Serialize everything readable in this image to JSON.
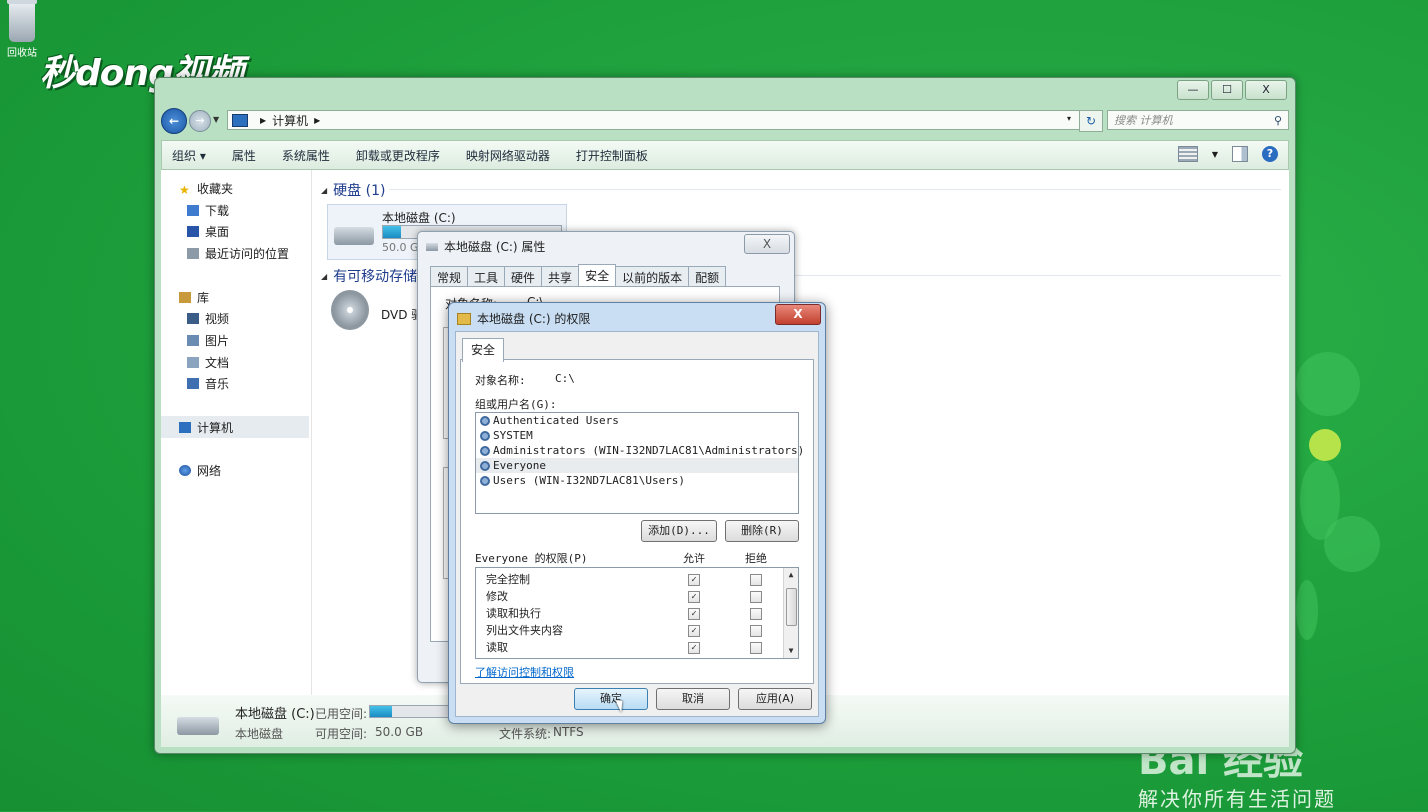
{
  "desktop": {
    "recycle_bin_label": "回收站",
    "brand_logo": "秒dong视频",
    "watermark_main": "Bai 经验",
    "watermark_sub": "解决你所有生活问题"
  },
  "explorer": {
    "window_buttons": {
      "minimize": "—",
      "maximize": "☐",
      "close": "X"
    },
    "address": {
      "root": "计算机",
      "dropdown": "▾"
    },
    "search_placeholder": "搜索 计算机",
    "toolbar": {
      "organize": "组织 ▾",
      "properties": "属性",
      "system_properties": "系统属性",
      "uninstall": "卸载或更改程序",
      "map_drive": "映射网络驱动器",
      "control_panel": "打开控制面板"
    },
    "nav": {
      "favorites": "收藏夹",
      "downloads": "下载",
      "desktop": "桌面",
      "recent": "最近访问的位置",
      "libraries": "库",
      "videos": "视频",
      "pictures": "图片",
      "documents": "文档",
      "music": "音乐",
      "computer": "计算机",
      "network": "网络"
    },
    "groups": {
      "hard_disks": "硬盘 (1)",
      "removable": "有可移动存储"
    },
    "drive_c": {
      "name": "本地磁盘 (C:)",
      "size": "50.0 GB",
      "used_fraction": 0.1
    },
    "dvd": {
      "name": "DVD 驱"
    },
    "details": {
      "name": "本地磁盘 (C:)",
      "type": "本地磁盘",
      "used_label": "已用空间:",
      "free_label": "可用空间:",
      "free_value": "50.0 GB",
      "fs_label": "文件系统:",
      "fs_value": "NTFS"
    }
  },
  "properties_dialog": {
    "title": "本地磁盘 (C:) 属性",
    "close": "X",
    "tabs": [
      "常规",
      "工具",
      "硬件",
      "共享",
      "安全",
      "以前的版本",
      "配额"
    ],
    "object_name_label": "对象名称:",
    "object_name_value": "C:\\"
  },
  "permissions_dialog": {
    "title": "本地磁盘 (C:) 的权限",
    "close": "X",
    "tab": "安全",
    "object_name_label": "对象名称:",
    "object_name_value": "C:\\",
    "users_label": "组或用户名(G):",
    "users": [
      "Authenticated Users",
      "SYSTEM",
      "Administrators (WIN-I32ND7LAC81\\Administrators)",
      "Everyone",
      "Users (WIN-I32ND7LAC81\\Users)"
    ],
    "selected_user_index": 3,
    "add_button": "添加(D)...",
    "remove_button": "删除(R)",
    "perm_header": "Everyone 的权限(P)",
    "allow_header": "允许",
    "deny_header": "拒绝",
    "permissions": [
      {
        "name": "完全控制",
        "allow": true,
        "deny": false
      },
      {
        "name": "修改",
        "allow": true,
        "deny": false
      },
      {
        "name": "读取和执行",
        "allow": true,
        "deny": false
      },
      {
        "name": "列出文件夹内容",
        "allow": true,
        "deny": false
      },
      {
        "name": "读取",
        "allow": true,
        "deny": false
      }
    ],
    "learn_link": "了解访问控制和权限",
    "ok_button": "确定",
    "cancel_button": "取消",
    "apply_button": "应用(A)"
  }
}
